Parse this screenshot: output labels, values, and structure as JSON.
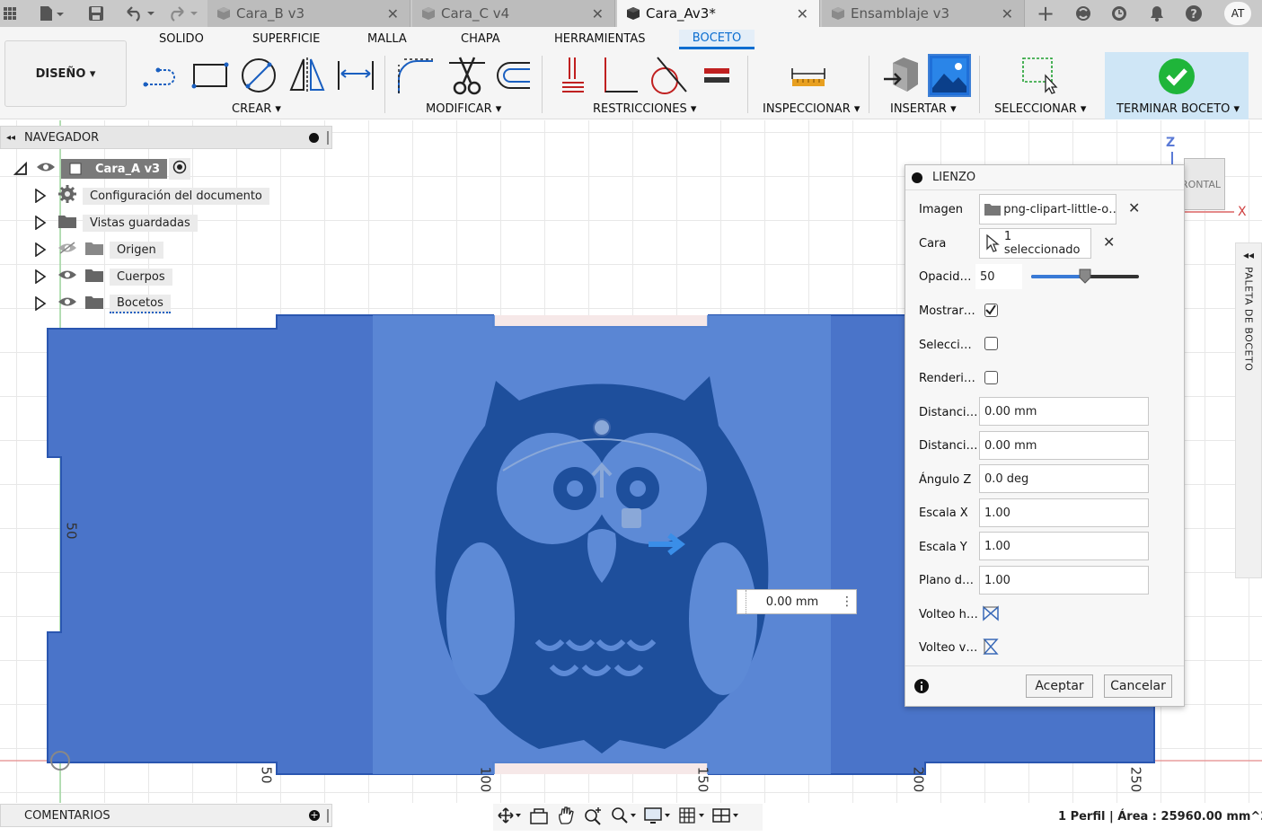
{
  "tabs": [
    {
      "label": "Cara_B v3",
      "active": false
    },
    {
      "label": "Cara_C v4",
      "active": false
    },
    {
      "label": "Cara_Av3*",
      "active": true
    },
    {
      "label": "Ensamblaje v3",
      "active": false
    }
  ],
  "user_initials": "AT",
  "menu_tabs": [
    "SOLIDO",
    "SUPERFICIE",
    "MALLA",
    "CHAPA",
    "HERRAMIENTAS",
    "BOCETO"
  ],
  "workspace_label": "DISEÑO ▾",
  "groups": {
    "crear": "CREAR ▾",
    "modificar": "MODIFICAR ▾",
    "restricciones": "RESTRICCIONES ▾",
    "inspeccionar": "INSPECCIONAR ▾",
    "insertar": "INSERTAR ▾",
    "seleccionar": "SELECCIONAR ▾",
    "terminar": "TERMINAR BOCETO ▾"
  },
  "navigator": {
    "title": "NAVEGADOR",
    "root": "Cara_A v3",
    "items": [
      "Configuración del documento",
      "Vistas guardadas",
      "Origen",
      "Cuerpos",
      "Bocetos"
    ]
  },
  "comments_label": "COMENTARIOS",
  "dialog": {
    "title": "LIENZO",
    "rows": {
      "imagen_label": "Imagen",
      "imagen_value": "png-clipart-little-o…",
      "cara_label": "Cara",
      "cara_value": "1 seleccionado",
      "opacidad_label": "Opacid…",
      "opacidad_value": "50",
      "opacidad_fraction": 0.5,
      "mostrar_label": "Mostrar…",
      "mostrar_checked": true,
      "seleccion_label": "Selecci…",
      "seleccion_checked": false,
      "render_label": "Renderi…",
      "render_checked": false,
      "dist1_label": "Distanci…",
      "dist1_value": "0.00 mm",
      "dist2_label": "Distanci…",
      "dist2_value": "0.00 mm",
      "angz_label": "Ángulo Z",
      "angz_value": "0.0 deg",
      "escx_label": "Escala X",
      "escx_value": "1.00",
      "escy_label": "Escala Y",
      "escy_value": "1.00",
      "plano_label": "Plano d…",
      "plano_value": "1.00",
      "volteoh_label": "Volteo h…",
      "volteov_label": "Volteo v…"
    },
    "accept": "Aceptar",
    "cancel": "Cancelar"
  },
  "canvas": {
    "dim_input": "0.00 mm",
    "ruler_vertical": "50",
    "ruler_bottom": [
      "50",
      "100",
      "150",
      "200",
      "250"
    ],
    "viewcube_label": "RONTAL",
    "axis_z": "Z",
    "axis_x": "X"
  },
  "palette_label": "PALETA DE BOCETO",
  "status": "1 Perfil | Área : 25960.00 mm^2",
  "colors": {
    "accent": "#0a6dd0",
    "sketch_fill": "#4a74c9",
    "owl_dark": "#1e4f9c",
    "finish_check": "#1fb53a"
  }
}
